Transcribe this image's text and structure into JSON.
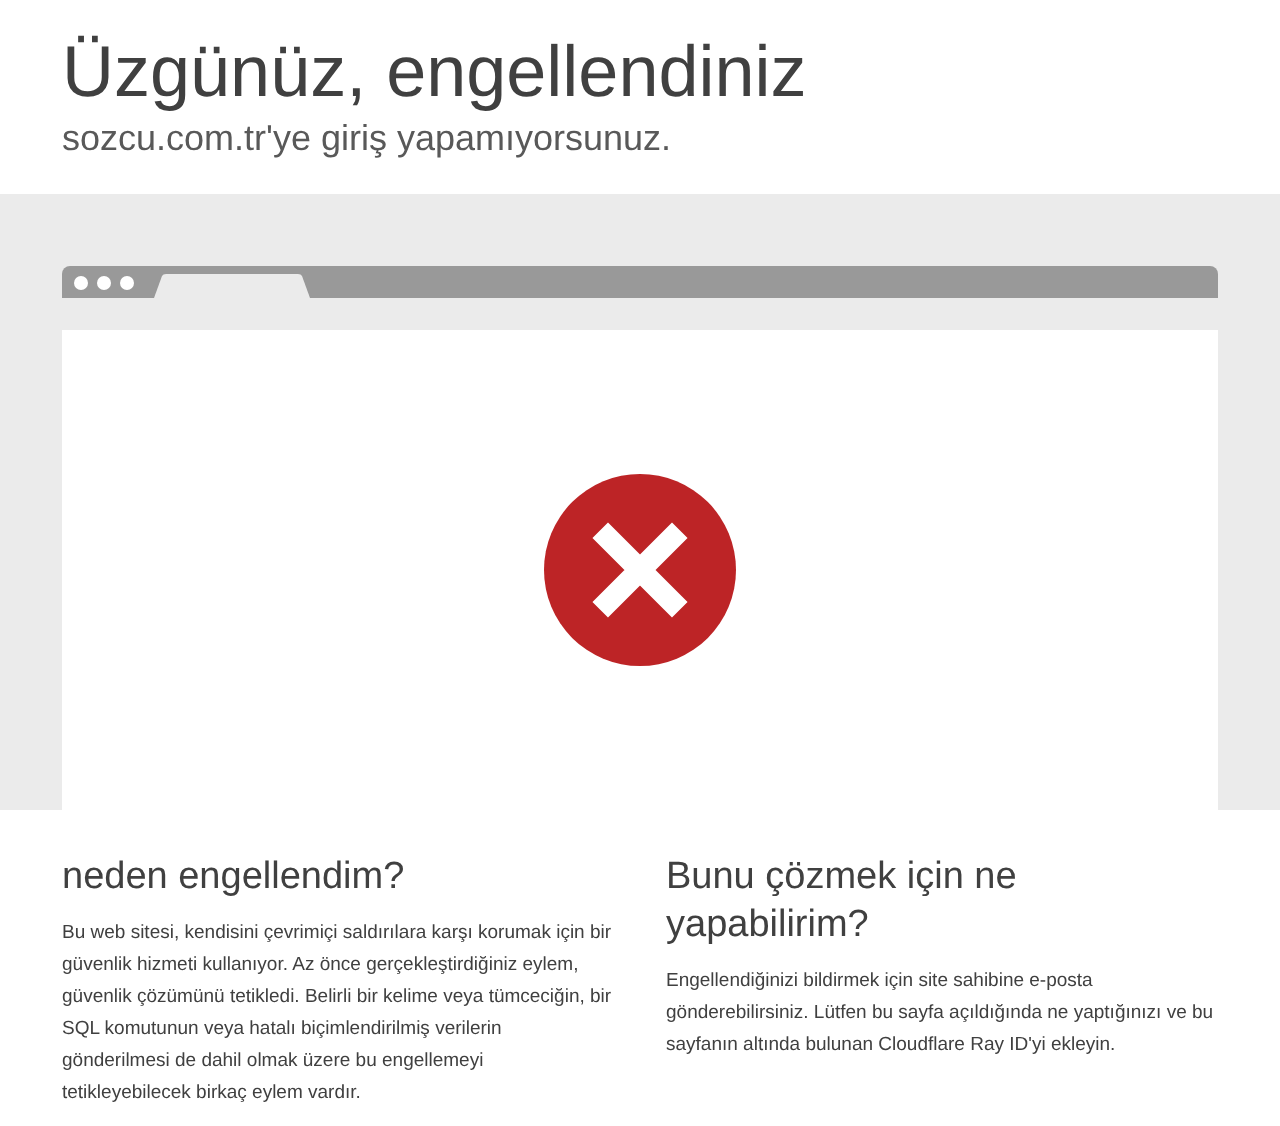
{
  "header": {
    "title": "Üzgünüz, engellendiniz",
    "subtitle": "sozcu.com.tr'ye giriş yapamıyorsunuz."
  },
  "sections": [
    {
      "heading": "neden engellendim?",
      "body": "Bu web sitesi, kendisini çevrimiçi saldırılara karşı korumak için bir güvenlik hizmeti kullanıyor. Az önce gerçekleştirdiğiniz eylem, güvenlik çözümünü tetikledi. Belirli bir kelime veya tümceciğin, bir SQL komutunun veya hatalı biçimlendirilmiş verilerin gönderilmesi de dahil olmak üzere bu engellemeyi tetikleyebilecek birkaç eylem vardır."
    },
    {
      "heading": "Bunu çözmek için ne yapabilirim?",
      "body": "Engellendiğinizi bildirmek için site sahibine e-posta gönderebilirsiniz. Lütfen bu sayfa açıldığında ne yaptığınızı ve bu sayfanın altında bulunan Cloudflare Ray ID'yi ekleyin."
    }
  ]
}
